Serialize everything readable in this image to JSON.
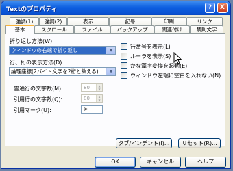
{
  "title": "Textのプロパティ",
  "title_buttons": {
    "help": "?",
    "close": "X"
  },
  "tabs_top": [
    "強調(1)",
    "強調(2)",
    "表示",
    "記号",
    "印刷",
    "リンク"
  ],
  "tabs_bottom": [
    "基本",
    "スクロール",
    "ファイル",
    "バックアップ",
    "関連付け",
    "禁則文字"
  ],
  "active_tab": "基本",
  "wrap_method": {
    "label": "折り返し方法(W):",
    "value": "ウィンドウの右端で折り返し"
  },
  "line_display": {
    "label": "行、桁の表示方法(D):",
    "value": "論理座標(2バイト文字を2桁と数える)"
  },
  "normal_chars": {
    "label": "普通行の文字数(M):",
    "value": "80"
  },
  "quote_chars": {
    "label": "引用行の文字数(Q):",
    "value": "80"
  },
  "quote_mark": {
    "label": "引用マーク(U):",
    "value": ">"
  },
  "checkboxes": [
    "行番号を表示(L)",
    "ルーラを表示(S)",
    "かな漢字変換を起動(E)",
    "ウィンドウ左端に空白を入れない(N)"
  ],
  "panel_buttons": {
    "tab_indent": "タブ/インデント(I)...",
    "reset": "リセット(R)..."
  },
  "dialog_buttons": {
    "ok": "OK",
    "cancel": "キャンセル",
    "help": "ヘルプ"
  },
  "icons": {
    "dropdown": "chevron-down-icon",
    "cursor": "mouse-pointer-icon"
  }
}
